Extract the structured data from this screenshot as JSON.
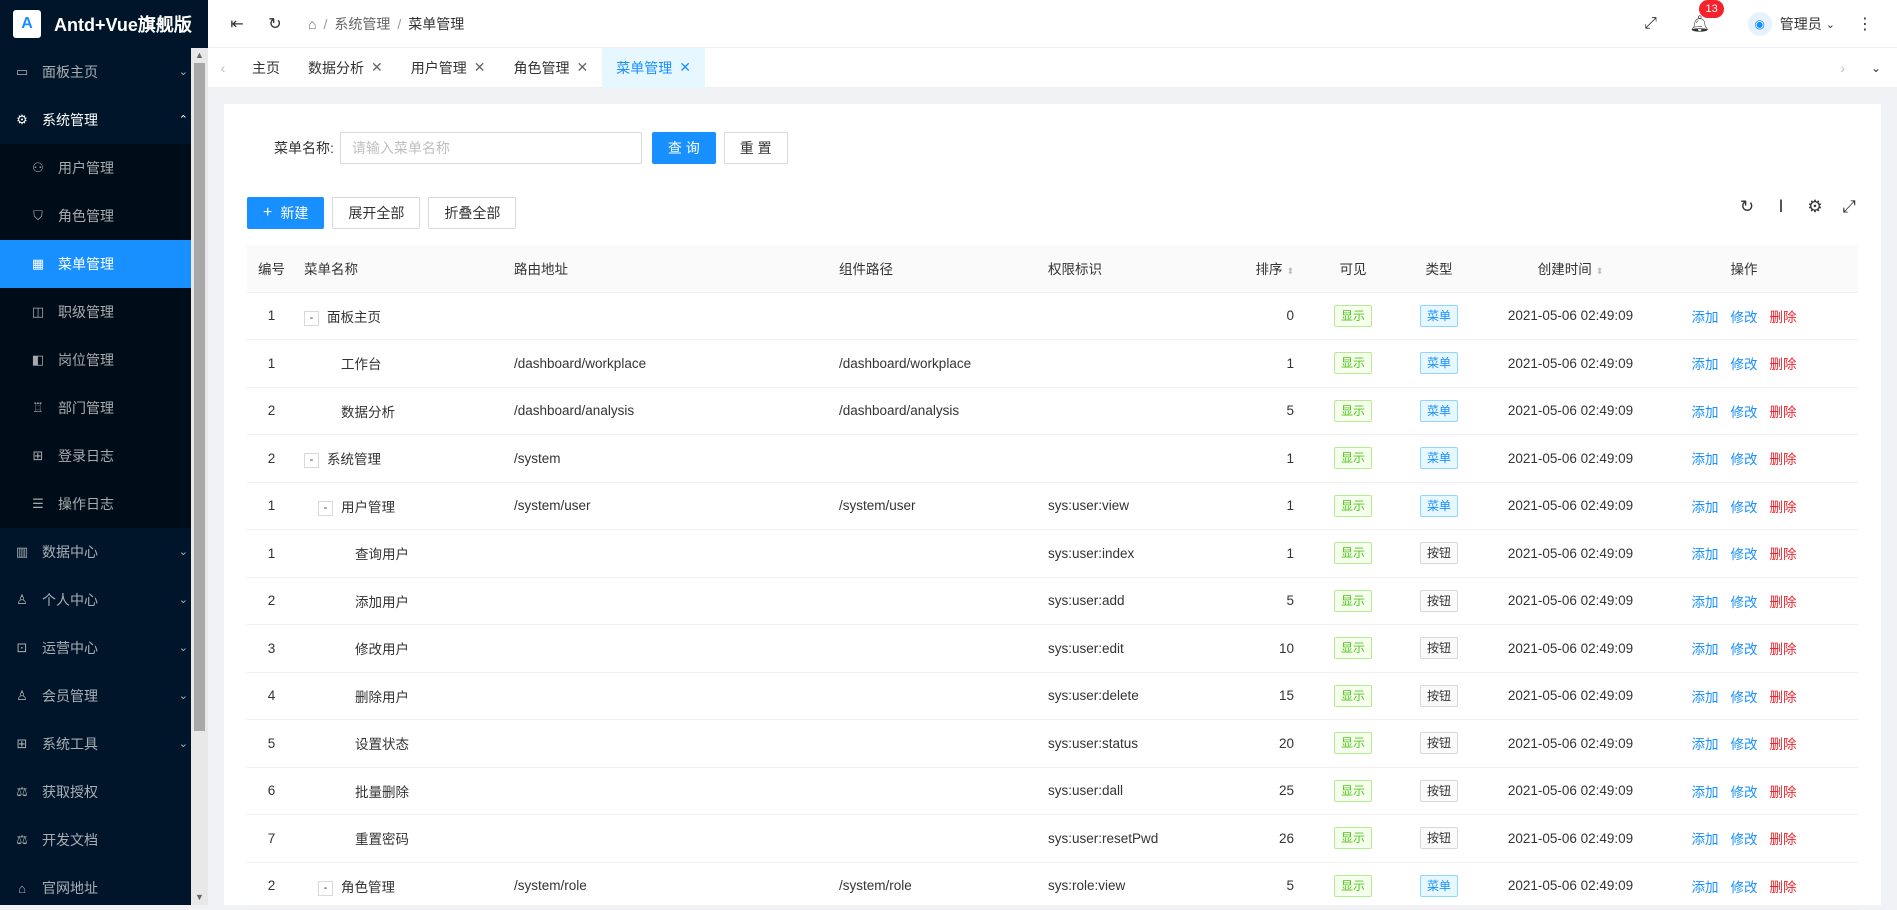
{
  "app": {
    "title": "Antd+Vue旗舰版",
    "logo_text": "A"
  },
  "menu": [
    {
      "label": "面板主页",
      "icon": "monitor-icon",
      "glyph": "▭",
      "arrow": "⌄"
    },
    {
      "label": "系统管理",
      "icon": "gear-icon",
      "glyph": "⚙",
      "arrow": "⌃",
      "open": true,
      "children": [
        {
          "label": "用户管理",
          "icon": "user-icon",
          "glyph": "⚇"
        },
        {
          "label": "角色管理",
          "icon": "shield-icon",
          "glyph": "⛉"
        },
        {
          "label": "菜单管理",
          "icon": "table-icon",
          "glyph": "▦",
          "active": true
        },
        {
          "label": "职级管理",
          "icon": "rank-icon",
          "glyph": "◫"
        },
        {
          "label": "岗位管理",
          "icon": "post-icon",
          "glyph": "◧"
        },
        {
          "label": "部门管理",
          "icon": "dept-icon",
          "glyph": "♖"
        },
        {
          "label": "登录日志",
          "icon": "grid-icon",
          "glyph": "⊞"
        },
        {
          "label": "操作日志",
          "icon": "list-icon",
          "glyph": "☰"
        }
      ]
    },
    {
      "label": "数据中心",
      "icon": "chart-icon",
      "glyph": "▥",
      "arrow": "⌄"
    },
    {
      "label": "个人中心",
      "icon": "person-icon",
      "glyph": "♙",
      "arrow": "⌄"
    },
    {
      "label": "运营中心",
      "icon": "scan-icon",
      "glyph": "⊡",
      "arrow": "⌄"
    },
    {
      "label": "会员管理",
      "icon": "member-icon",
      "glyph": "♙",
      "arrow": "⌄"
    },
    {
      "label": "系统工具",
      "icon": "tool-icon",
      "glyph": "⊞",
      "arrow": "⌄"
    },
    {
      "label": "获取授权",
      "icon": "license-icon",
      "glyph": "⚖"
    },
    {
      "label": "开发文档",
      "icon": "doc-icon",
      "glyph": "⚖"
    },
    {
      "label": "官网地址",
      "icon": "link-icon",
      "glyph": "⌂"
    }
  ],
  "header": {
    "breadcrumb": [
      "系统管理",
      "菜单管理"
    ],
    "notification_count": "13",
    "user_name": "管理员"
  },
  "tabs": [
    {
      "label": "主页",
      "closable": false
    },
    {
      "label": "数据分析",
      "closable": true
    },
    {
      "label": "用户管理",
      "closable": true
    },
    {
      "label": "角色管理",
      "closable": true
    },
    {
      "label": "菜单管理",
      "closable": true,
      "active": true
    }
  ],
  "search": {
    "label": "菜单名称:",
    "placeholder": "请输入菜单名称",
    "query_btn": "查 询",
    "reset_btn": "重 置"
  },
  "toolbar": {
    "new_btn": "新建",
    "expand_btn": "展开全部",
    "collapse_btn": "折叠全部"
  },
  "table": {
    "columns": [
      "编号",
      "菜单名称",
      "路由地址",
      "组件路径",
      "权限标识",
      "排序",
      "可见",
      "类型",
      "创建时间",
      "操作"
    ],
    "actions": {
      "add": "添加",
      "edit": "修改",
      "delete": "删除"
    },
    "rows": [
      {
        "no": "1",
        "name": "面板主页",
        "indent": 0,
        "expand": "-",
        "route": "",
        "component": "",
        "perm": "",
        "sort": "0",
        "visible": "显示",
        "type": "菜单",
        "created": "2021-05-06 02:49:09"
      },
      {
        "no": "1",
        "name": "工作台",
        "indent": 1,
        "expand": "",
        "route": "/dashboard/workplace",
        "component": "/dashboard/workplace",
        "perm": "",
        "sort": "1",
        "visible": "显示",
        "type": "菜单",
        "created": "2021-05-06 02:49:09"
      },
      {
        "no": "2",
        "name": "数据分析",
        "indent": 1,
        "expand": "",
        "route": "/dashboard/analysis",
        "component": "/dashboard/analysis",
        "perm": "",
        "sort": "5",
        "visible": "显示",
        "type": "菜单",
        "created": "2021-05-06 02:49:09"
      },
      {
        "no": "2",
        "name": "系统管理",
        "indent": 0,
        "expand": "-",
        "route": "/system",
        "component": "",
        "perm": "",
        "sort": "1",
        "visible": "显示",
        "type": "菜单",
        "created": "2021-05-06 02:49:09"
      },
      {
        "no": "1",
        "name": "用户管理",
        "indent": 1,
        "expand": "-",
        "route": "/system/user",
        "component": "/system/user",
        "perm": "sys:user:view",
        "sort": "1",
        "visible": "显示",
        "type": "菜单",
        "created": "2021-05-06 02:49:09"
      },
      {
        "no": "1",
        "name": "查询用户",
        "indent": 2,
        "expand": "",
        "route": "",
        "component": "",
        "perm": "sys:user:index",
        "sort": "1",
        "visible": "显示",
        "type": "按钮",
        "created": "2021-05-06 02:49:09"
      },
      {
        "no": "2",
        "name": "添加用户",
        "indent": 2,
        "expand": "",
        "route": "",
        "component": "",
        "perm": "sys:user:add",
        "sort": "5",
        "visible": "显示",
        "type": "按钮",
        "created": "2021-05-06 02:49:09"
      },
      {
        "no": "3",
        "name": "修改用户",
        "indent": 2,
        "expand": "",
        "route": "",
        "component": "",
        "perm": "sys:user:edit",
        "sort": "10",
        "visible": "显示",
        "type": "按钮",
        "created": "2021-05-06 02:49:09"
      },
      {
        "no": "4",
        "name": "删除用户",
        "indent": 2,
        "expand": "",
        "route": "",
        "component": "",
        "perm": "sys:user:delete",
        "sort": "15",
        "visible": "显示",
        "type": "按钮",
        "created": "2021-05-06 02:49:09"
      },
      {
        "no": "5",
        "name": "设置状态",
        "indent": 2,
        "expand": "",
        "route": "",
        "component": "",
        "perm": "sys:user:status",
        "sort": "20",
        "visible": "显示",
        "type": "按钮",
        "created": "2021-05-06 02:49:09"
      },
      {
        "no": "6",
        "name": "批量删除",
        "indent": 2,
        "expand": "",
        "route": "",
        "component": "",
        "perm": "sys:user:dall",
        "sort": "25",
        "visible": "显示",
        "type": "按钮",
        "created": "2021-05-06 02:49:09"
      },
      {
        "no": "7",
        "name": "重置密码",
        "indent": 2,
        "expand": "",
        "route": "",
        "component": "",
        "perm": "sys:user:resetPwd",
        "sort": "26",
        "visible": "显示",
        "type": "按钮",
        "created": "2021-05-06 02:49:09"
      },
      {
        "no": "2",
        "name": "角色管理",
        "indent": 1,
        "expand": "-",
        "route": "/system/role",
        "component": "/system/role",
        "perm": "sys:role:view",
        "sort": "5",
        "visible": "显示",
        "type": "菜单",
        "created": "2021-05-06 02:49:09"
      }
    ]
  }
}
